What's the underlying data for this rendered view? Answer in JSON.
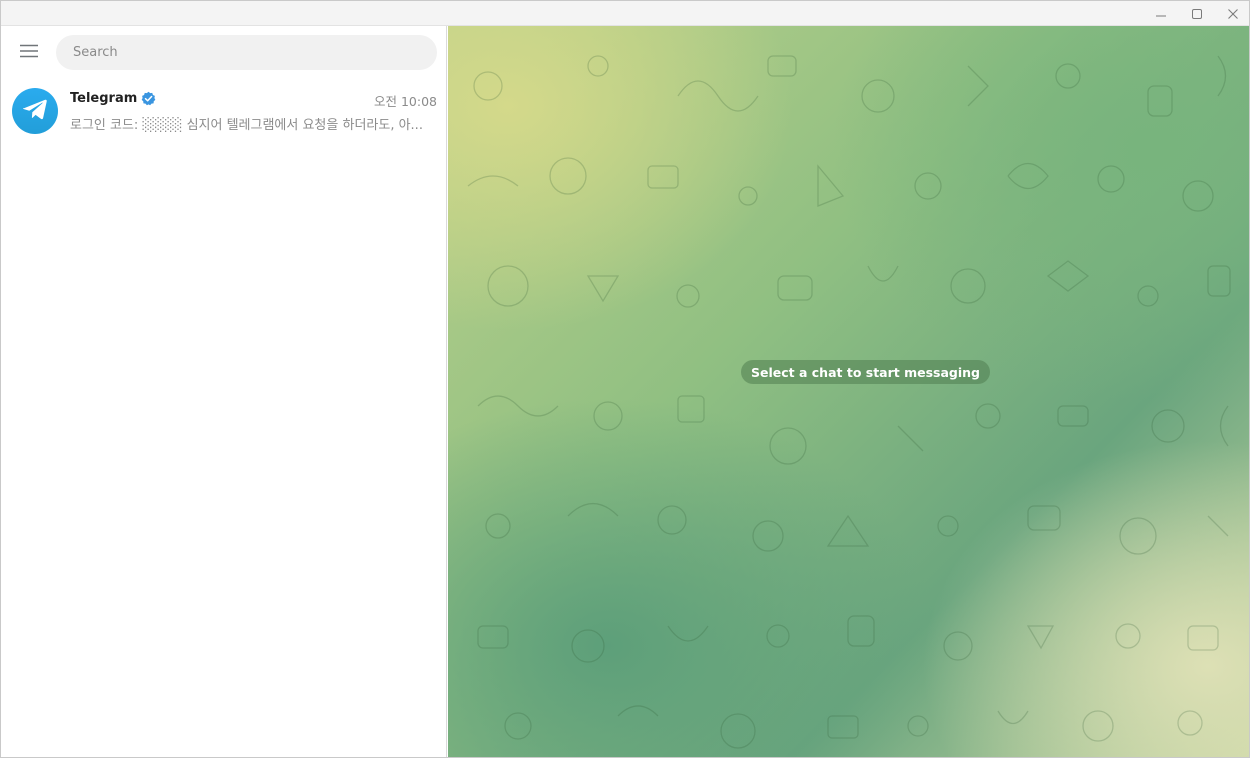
{
  "search": {
    "placeholder": "Search"
  },
  "chats": [
    {
      "name": "Telegram",
      "verified": true,
      "time": "오전 10:08",
      "preview": "로그인 코드: ░░░░ 심지어 텔레그램에서 요청을 하더라도, 아..."
    }
  ],
  "main": {
    "empty_message": "Select a chat to start messaging"
  },
  "icons": {
    "menu": "hamburger-icon",
    "minimize": "minimize-icon",
    "maximize": "maximize-icon",
    "close": "close-icon",
    "avatar": "telegram-logo-icon",
    "verified": "verified-badge-icon"
  },
  "colors": {
    "accent": "#2aabee",
    "verified": "#3a95e0",
    "wallpaper_green": "#78b47d",
    "wallpaper_yellow": "#d4d98a"
  }
}
